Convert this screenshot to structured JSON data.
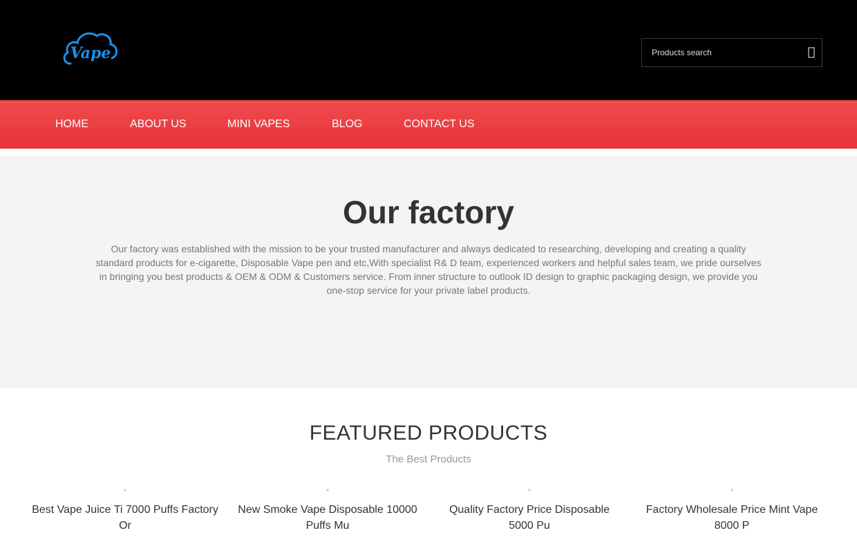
{
  "header": {
    "logo_text": "Vape",
    "search": {
      "placeholder": "Products search",
      "button_icon": "search-icon"
    }
  },
  "nav": {
    "items": [
      {
        "label": "HOME"
      },
      {
        "label": "ABOUT US"
      },
      {
        "label": "MINI VAPES"
      },
      {
        "label": "BLOG"
      },
      {
        "label": "CONTACT US"
      }
    ]
  },
  "factory": {
    "title": "Our factory",
    "description": "Our factory was established with the mission to be your trusted manufacturer and always dedicated to researching, developing and creating a quality standard products for e-cigarette, Disposable Vape pen and etc,With specialist R& D team, experienced workers and helpful sales team, we pride ourselves in bringing you best products & OEM & ODM & Customers service. From inner structure to outlook ID design to graphic packaging design, we provide you one-stop service for your private label products."
  },
  "featured": {
    "title": "FEATURED PRODUCTS",
    "subtitle": "The Best Products",
    "products": [
      {
        "name": "Best Vape Juice Ti 7000 Puffs Factory Or"
      },
      {
        "name": "New Smoke Vape Disposable 10000 Puffs Mu"
      },
      {
        "name": "Quality Factory Price Disposable 5000 Pu"
      },
      {
        "name": "Factory Wholesale Price Mint Vape 8000 P"
      }
    ]
  },
  "colors": {
    "header_bg": "#000000",
    "nav_bg": "#e8393d",
    "logo_blue": "#1e90e6",
    "factory_bg": "#f4f4f4"
  }
}
